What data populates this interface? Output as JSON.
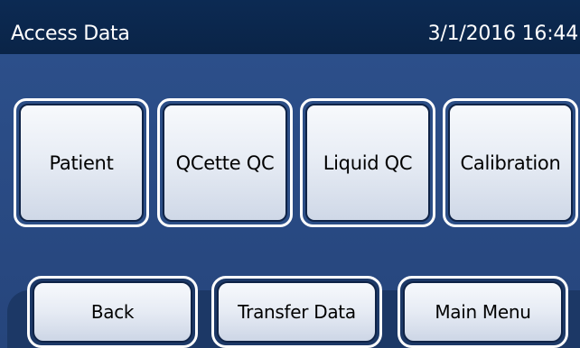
{
  "header": {
    "title": "Access Data",
    "datetime": "3/1/2016 16:44"
  },
  "main": {
    "tiles": [
      {
        "label": "Patient"
      },
      {
        "label": "QCette QC"
      },
      {
        "label": "Liquid QC"
      },
      {
        "label": "Calibration"
      }
    ]
  },
  "nav": {
    "back": "Back",
    "transfer": "Transfer Data",
    "main_menu": "Main Menu"
  },
  "colors": {
    "header_bg": "#0c2a53",
    "content_bg": "#2c4f8a",
    "bottom_bar_bg": "#1c3866",
    "button_border": "#ffffff"
  }
}
